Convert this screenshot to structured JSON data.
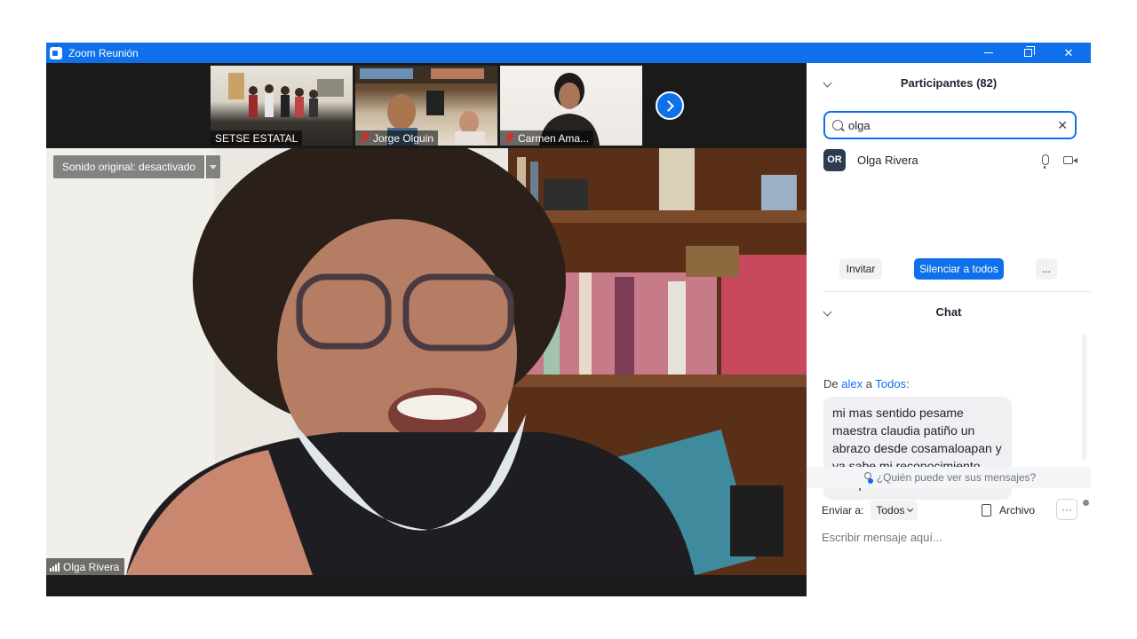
{
  "window": {
    "title": "Zoom Reunión",
    "controls": [
      "minimize-icon",
      "restore-icon",
      "close-icon"
    ],
    "accent_color": "#0e71eb"
  },
  "video": {
    "thumbnails": [
      {
        "name": "SETSE ESTATAL",
        "muted": false
      },
      {
        "name": "Jorge Olguin",
        "muted": true
      },
      {
        "name": "Carmen Ama...",
        "muted": true
      }
    ],
    "next_page_icon": "chevron-right-icon",
    "sound_label": "Sonido original: desactivado",
    "active_speaker": "Olga Rivera"
  },
  "participants": {
    "header": "Participantes (82)",
    "search_value": "olga",
    "clear_symbol": "✕",
    "list": [
      {
        "initials": "OR",
        "name": "Olga Rivera"
      }
    ],
    "invite_label": "Invitar",
    "mute_all_label": "Silenciar a todos",
    "more_label": "..."
  },
  "chat": {
    "header": "Chat",
    "message": {
      "prefix": "De",
      "from": "alex",
      "to_word": "a",
      "to": "Todos",
      "suffix": ":",
      "text": "mi mas sentido pesame maestra claudia patiño un abrazo desde cosamaloapan y ya sabe mi reconocimiento siempre te recuerdo"
    },
    "who_can_see": "¿Quién puede ver sus mensajes?",
    "send_to_label": "Enviar a:",
    "send_to_value": "Todos",
    "file_label": "Archivo",
    "more_label": "···",
    "placeholder": "Escribir mensaje aquí..."
  }
}
